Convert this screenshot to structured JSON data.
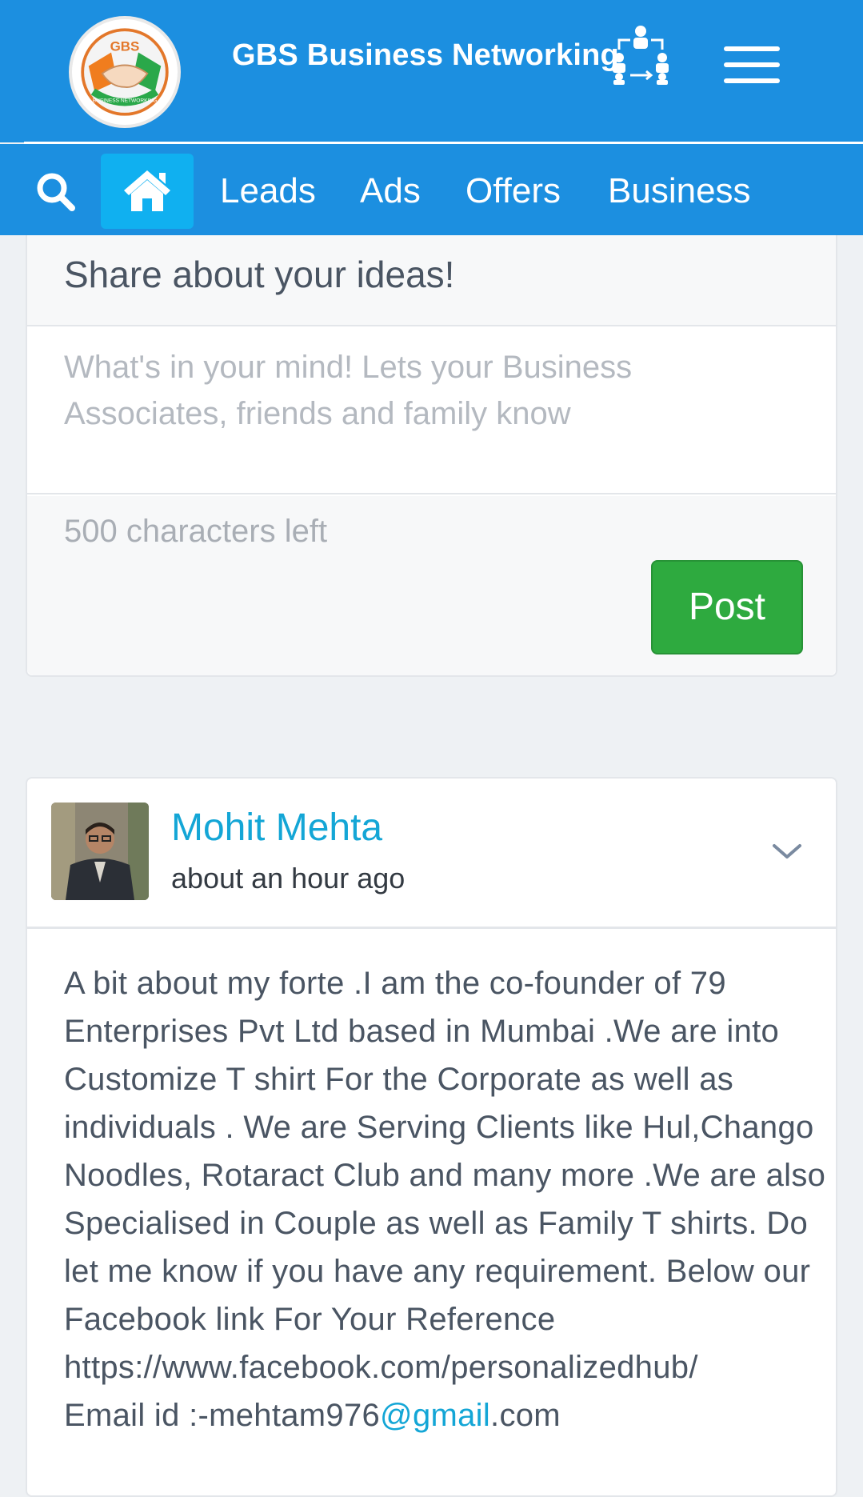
{
  "header": {
    "title": "GBS Business Networking",
    "logo_text": "GBS",
    "logo_ribbon_text": "BUSINESS NETWORKING",
    "brand_color": "#1c8fe0"
  },
  "nav": {
    "items": [
      {
        "label": "Leads"
      },
      {
        "label": "Ads"
      },
      {
        "label": "Offers"
      },
      {
        "label": "Business"
      }
    ],
    "active": "home",
    "active_color": "#10b0f0"
  },
  "share": {
    "title": "Share about your ideas!",
    "placeholder": "What's in your mind! Lets your Business Associates, friends and family know",
    "chars_left": "500 characters left",
    "post_label": "Post",
    "post_color": "#2eaa3f"
  },
  "post": {
    "author": "Mohit Mehta",
    "time": "about an hour ago",
    "body": "A bit about my forte .I am the co-founder of 79 Enterprises Pvt Ltd based in Mumbai .We are into Customize T shirt For the Corporate as well as individuals . We are Serving Clients like Hul,Chango Noodles, Rotaract Club and many more .We are also Specialised in Couple as well as Family T shirts. Do let me know if you have any requirement. Below our Facebook link For Your Reference",
    "fb_link": "https://www.facebook.com/personalizedhub/",
    "email_prefix": "Email id :-mehtam976",
    "email_link": "@gmail",
    "email_suffix": ".com"
  },
  "icons": {
    "search": "search-icon",
    "home": "home-icon",
    "menu": "hamburger-menu-icon",
    "network": "network-people-icon",
    "chevron": "chevron-down-icon"
  }
}
